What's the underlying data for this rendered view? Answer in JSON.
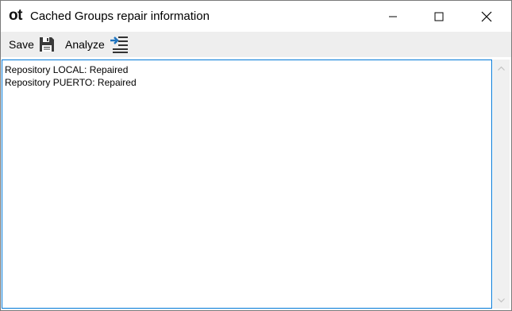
{
  "window": {
    "logo": "ot",
    "title": "Cached Groups repair information"
  },
  "toolbar": {
    "save_label": "Save",
    "save_icon": "floppy-disk-icon",
    "analyze_label": "Analyze",
    "analyze_icon": "indent-list-icon"
  },
  "content": {
    "lines": [
      "Repository LOCAL: Repaired",
      "Repository PUERTO: Repaired"
    ]
  },
  "colors": {
    "toolbar_bg": "#eeeeee",
    "focus_border": "#0078d7",
    "accent_blue": "#1e73be",
    "scrollbar_bg": "#f0f0f0"
  }
}
